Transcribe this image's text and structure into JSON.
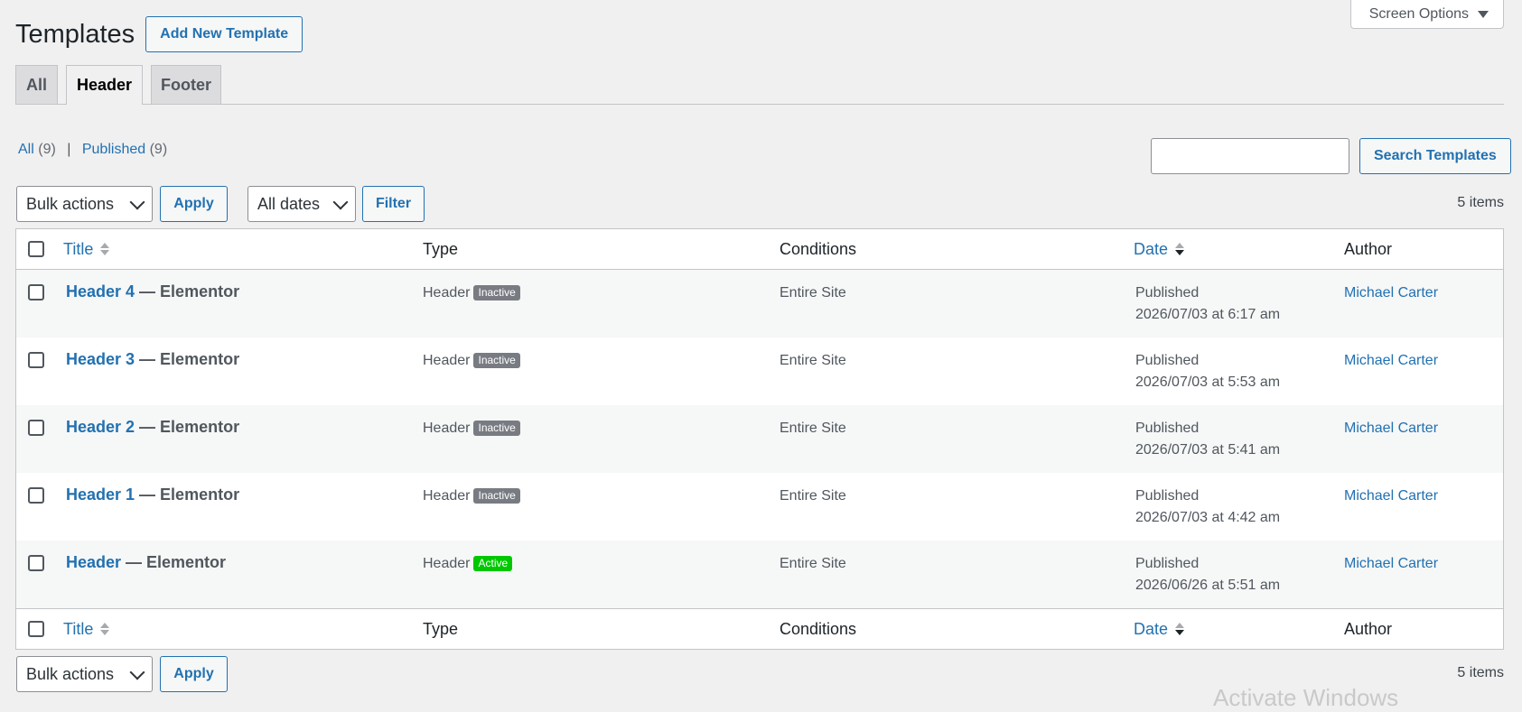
{
  "screen_options": {
    "label": "Screen Options"
  },
  "header": {
    "title": "Templates",
    "add_new_label": "Add New Template"
  },
  "tabs": [
    {
      "label": "All",
      "active": false
    },
    {
      "label": "Header",
      "active": true
    },
    {
      "label": "Footer",
      "active": false
    }
  ],
  "filters": {
    "all": {
      "label": "All",
      "count": "(9)"
    },
    "separator": "|",
    "published": {
      "label": "Published",
      "count": "(9)"
    }
  },
  "search": {
    "value": "",
    "button_label": "Search Templates"
  },
  "tablenav_top": {
    "bulk_actions": "Bulk actions",
    "apply": "Apply",
    "dates": "All dates",
    "filter": "Filter",
    "items": "5 items"
  },
  "tablenav_bottom": {
    "bulk_actions": "Bulk actions",
    "apply": "Apply",
    "items": "5 items"
  },
  "columns": {
    "title": "Title",
    "type": "Type",
    "conditions": "Conditions",
    "date": "Date",
    "author": "Author"
  },
  "rows": [
    {
      "name": "Header 4",
      "suffix": " — Elementor",
      "type": "Header",
      "status": "Inactive",
      "conditions": "Entire Site",
      "date_status": "Published",
      "date": "2026/07/03 at 6:17 am",
      "author": "Michael Carter"
    },
    {
      "name": "Header 3",
      "suffix": " — Elementor",
      "type": "Header",
      "status": "Inactive",
      "conditions": "Entire Site",
      "date_status": "Published",
      "date": "2026/07/03 at 5:53 am",
      "author": "Michael Carter"
    },
    {
      "name": "Header 2",
      "suffix": " — Elementor",
      "type": "Header",
      "status": "Inactive",
      "conditions": "Entire Site",
      "date_status": "Published",
      "date": "2026/07/03 at 5:41 am",
      "author": "Michael Carter"
    },
    {
      "name": "Header 1",
      "suffix": " — Elementor",
      "type": "Header",
      "status": "Inactive",
      "conditions": "Entire Site",
      "date_status": "Published",
      "date": "2026/07/03 at 4:42 am",
      "author": "Michael Carter"
    },
    {
      "name": "Header",
      "suffix": " — Elementor",
      "type": "Header",
      "status": "Active",
      "conditions": "Entire Site",
      "date_status": "Published",
      "date": "2026/06/26 at 5:51 am",
      "author": "Michael Carter"
    }
  ],
  "colors": {
    "accent": "#2271b1",
    "badge_inactive": "#787c82",
    "badge_active": "#00c800"
  },
  "watermark": "Activate Windows"
}
